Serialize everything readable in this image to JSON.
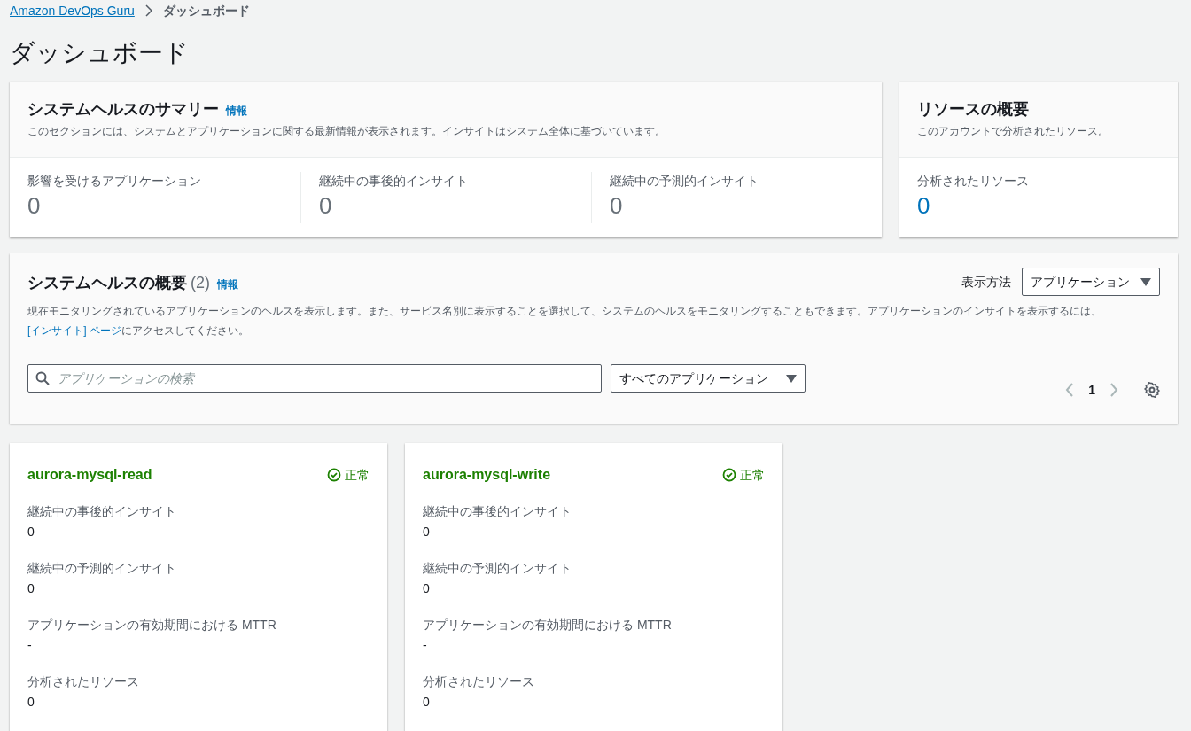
{
  "breadcrumb": [
    {
      "label": "Amazon DevOps Guru",
      "kind": "link"
    },
    {
      "label": "ダッシュボード",
      "kind": "current"
    }
  ],
  "page_title": "ダッシュボード",
  "summary": {
    "title": "システムヘルスのサマリー",
    "info": "情報",
    "description": "このセクションには、システムとアプリケーションに関する最新情報が表示されます。インサイトはシステム全体に基づいています。",
    "metrics": [
      {
        "label": "影響を受けるアプリケーション",
        "value": "0"
      },
      {
        "label": "継続中の事後的インサイト",
        "value": "0"
      },
      {
        "label": "継続中の予測的インサイト",
        "value": "0"
      }
    ]
  },
  "resources": {
    "title": "リソースの概要",
    "description": "このアカウントで分析されたリソース。",
    "metrics": [
      {
        "label": "分析されたリソース",
        "value": "0"
      }
    ]
  },
  "overview": {
    "title": "システムヘルスの概要",
    "count": "(2)",
    "info": "情報",
    "description": "現在モニタリングされているアプリケーションのヘルスを表示します。また、サービス名別に表示することを選択して、システムのヘルスをモニタリングすることもできます。アプリケーションのインサイトを表示するには、",
    "link": "[インサイト] ページ",
    "description_after": "にアクセスしてください。",
    "view_label": "表示方法",
    "view_select": "アプリケーション",
    "search": {
      "placeholder": "アプリケーションの検索"
    },
    "filter_select": "すべてのアプリケーション",
    "page": "1"
  },
  "apps": [
    {
      "name": "aurora-mysql-read",
      "status": "正常",
      "healthy": true,
      "fields": [
        {
          "label": "継続中の事後的インサイト",
          "value": "0"
        },
        {
          "label": "継続中の予測的インサイト",
          "value": "0"
        },
        {
          "label": "アプリケーションの有効期間における MTTR",
          "value": "-"
        },
        {
          "label": "分析されたリソース",
          "value": "0"
        }
      ]
    },
    {
      "name": "aurora-mysql-write",
      "status": "正常",
      "healthy": true,
      "fields": [
        {
          "label": "継続中の事後的インサイト",
          "value": "0"
        },
        {
          "label": "継続中の予測的インサイト",
          "value": "0"
        },
        {
          "label": "アプリケーションの有効期間における MTTR",
          "value": "-"
        },
        {
          "label": "分析されたリソース",
          "value": "0"
        }
      ]
    }
  ]
}
